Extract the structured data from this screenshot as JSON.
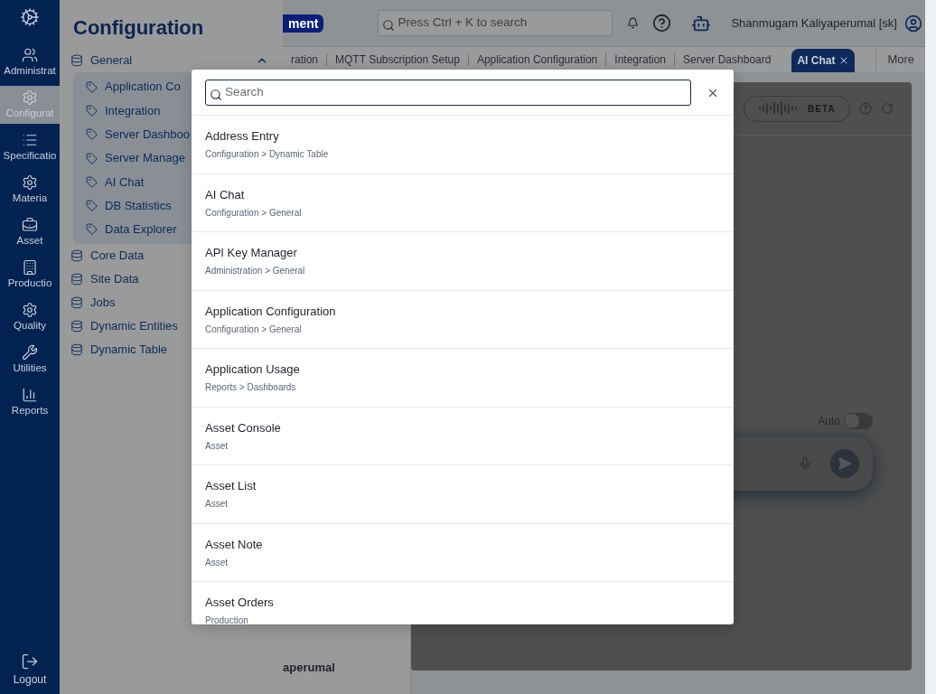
{
  "rail": {
    "items": [
      {
        "label": "Administrat",
        "selected": false
      },
      {
        "label": "Configurat",
        "selected": true
      },
      {
        "label": "Specificatio",
        "selected": false
      },
      {
        "label": "Materia",
        "selected": false
      },
      {
        "label": "Asset",
        "selected": false
      },
      {
        "label": "Productio",
        "selected": false
      },
      {
        "label": "Quality",
        "selected": false
      },
      {
        "label": "Utilities",
        "selected": false
      },
      {
        "label": "Reports",
        "selected": false
      }
    ],
    "logout": "Logout"
  },
  "config_panel": {
    "title": "Configuration",
    "groups": [
      {
        "label": "General",
        "expanded": true,
        "children": [
          "Application Co",
          "Integration",
          "Server Dashboo",
          "Server Manage",
          "AI Chat",
          "DB Statistics",
          "Data Explorer"
        ]
      },
      {
        "label": "Core Data",
        "expanded": false
      },
      {
        "label": "Site Data",
        "expanded": false
      },
      {
        "label": "Jobs",
        "expanded": false
      },
      {
        "label": "Dynamic Entities",
        "expanded": false
      },
      {
        "label": "Dynamic Table",
        "expanded": false
      }
    ]
  },
  "header": {
    "badge": "ment",
    "search_placeholder": "Press Ctrl + K to search",
    "user": "Shanmugam Kaliyaperumal [sk]"
  },
  "tabs": [
    {
      "label": "ration",
      "selected": false
    },
    {
      "label": "MQTT Subscription Setup",
      "selected": false
    },
    {
      "label": "Application Configuration",
      "selected": false
    },
    {
      "label": "Integration",
      "selected": false
    },
    {
      "label": "Server Dashboard",
      "selected": false
    },
    {
      "label": "AI Chat",
      "selected": true
    }
  ],
  "more": "More",
  "chat": {
    "beta": "BETA",
    "auto_label": "Auto",
    "auto_on": false
  },
  "left_column_text": "aperumal",
  "search_modal": {
    "placeholder": "Search",
    "results": [
      {
        "title": "Address Entry",
        "path": "Configuration > Dynamic Table"
      },
      {
        "title": "AI Chat",
        "path": "Configuration > General"
      },
      {
        "title": "API Key Manager",
        "path": "Administration > General"
      },
      {
        "title": "Application Configuration",
        "path": "Configuration > General"
      },
      {
        "title": "Application Usage",
        "path": "Reports > Dashboards"
      },
      {
        "title": "Asset Console",
        "path": "Asset"
      },
      {
        "title": "Asset List",
        "path": "Asset"
      },
      {
        "title": "Asset Note",
        "path": "Asset"
      },
      {
        "title": "Asset Orders",
        "path": "Production"
      }
    ]
  }
}
